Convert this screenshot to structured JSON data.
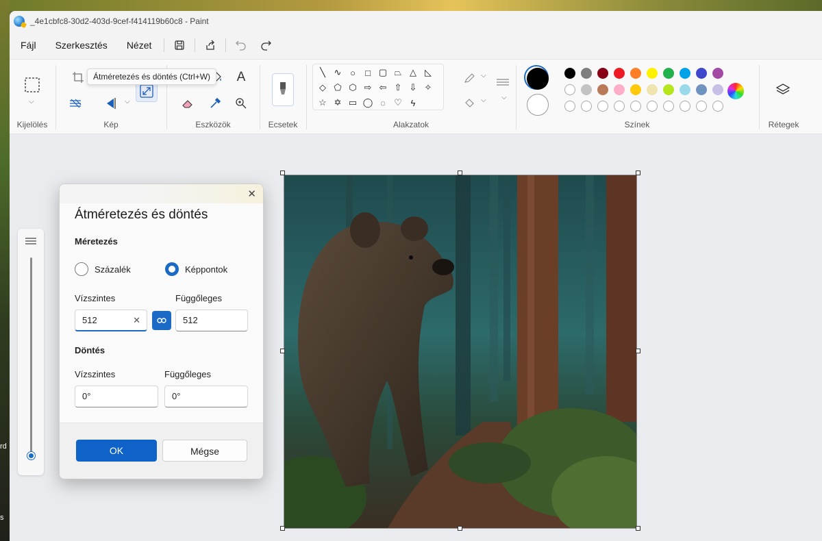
{
  "window": {
    "title": "_4e1cbfc8-30d2-403d-9cef-f414119b60c8 - Paint"
  },
  "desktop": {
    "left_text_1": "rd",
    "left_text_2": "s"
  },
  "menu": {
    "file": "Fájl",
    "edit": "Szerkesztés",
    "view": "Nézet"
  },
  "tooltip": "Átméretezés és döntés (Ctrl+W)",
  "ribbon": {
    "groups": {
      "selection": "Kijelölés",
      "image": "Kép",
      "tools": "Eszközök",
      "brushes": "Ecsetek",
      "shapes": "Alakzatok",
      "colors": "Színek",
      "layers": "Rétegek"
    },
    "tool_icons": {
      "text": "A"
    },
    "colors": {
      "primary": "#000000",
      "secondary": "#ffffff",
      "row1": [
        "#000000",
        "#7f7f7f",
        "#880015",
        "#ed1c24",
        "#ff7f27",
        "#fff200",
        "#22b14c",
        "#00a2e8",
        "#3f48cc",
        "#a349a4"
      ],
      "row2": [
        "#ffffff",
        "#c3c3c3",
        "#b97a57",
        "#ffaec9",
        "#ffc90e",
        "#efe4b0",
        "#b5e61d",
        "#99d9ea",
        "#7092be",
        "#c8bfe7"
      ]
    }
  },
  "dialog": {
    "title": "Átméretezés és döntés",
    "resize_heading": "Méretezés",
    "percent_label": "Százalék",
    "pixels_label": "Képpontok",
    "horizontal_label": "Vízszintes",
    "vertical_label": "Függőleges",
    "width_value": "512",
    "height_value": "512",
    "skew_heading": "Döntés",
    "skew_horizontal_label": "Vízszintes",
    "skew_vertical_label": "Függőleges",
    "skew_h_value": "0°",
    "skew_v_value": "0°",
    "ok_label": "OK",
    "cancel_label": "Mégse"
  }
}
